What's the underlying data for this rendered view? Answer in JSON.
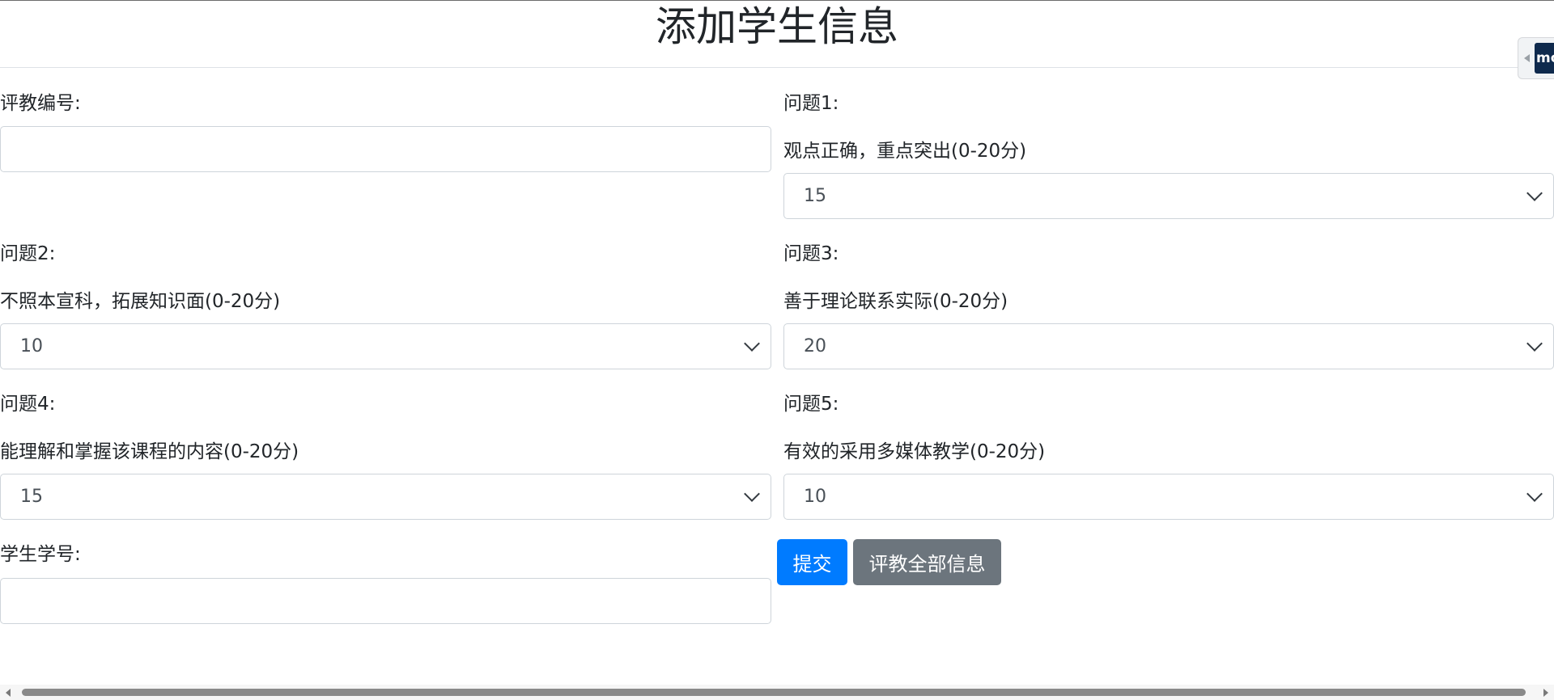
{
  "page": {
    "title": "添加学生信息"
  },
  "form": {
    "eval_id": {
      "label": "评教编号:",
      "value": ""
    },
    "questions": [
      {
        "label": "问题1:",
        "desc": "观点正确，重点突出(0-20分)",
        "value": "15"
      },
      {
        "label": "问题2:",
        "desc": "不照本宣科，拓展知识面(0-20分)",
        "value": "10"
      },
      {
        "label": "问题3:",
        "desc": "善于理论联系实际(0-20分)",
        "value": "20"
      },
      {
        "label": "问题4:",
        "desc": "能理解和掌握该课程的内容(0-20分)",
        "value": "15"
      },
      {
        "label": "问题5:",
        "desc": "有效的采用多媒体教学(0-20分)",
        "value": "10"
      }
    ],
    "student_id": {
      "label": "学生学号:",
      "value": ""
    },
    "submit_label": "提交",
    "all_info_label": "评教全部信息"
  },
  "side_tab": {
    "logo_text": "mo"
  },
  "colors": {
    "primary": "#007bff",
    "secondary": "#6c757d",
    "border": "#ced4da"
  }
}
